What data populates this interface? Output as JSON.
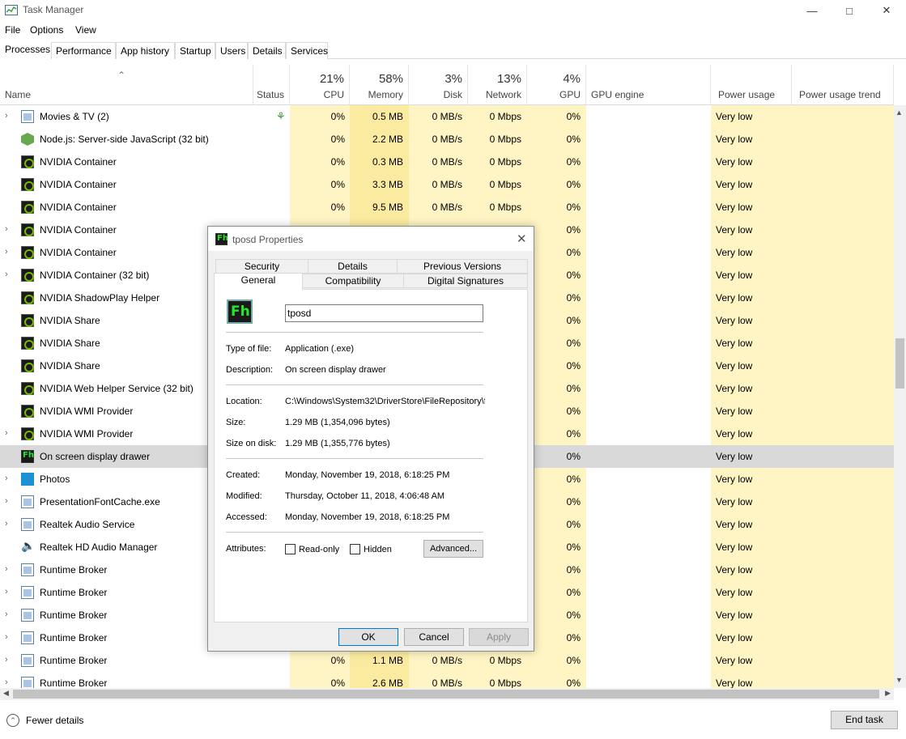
{
  "window": {
    "title": "Task Manager"
  },
  "menu": [
    "File",
    "Options",
    "View"
  ],
  "tabs": [
    "Processes",
    "Performance",
    "App history",
    "Startup",
    "Users",
    "Details",
    "Services"
  ],
  "header": {
    "name": "Name",
    "status": "Status",
    "cpu": {
      "pct": "21%",
      "label": "CPU"
    },
    "memory": {
      "pct": "58%",
      "label": "Memory"
    },
    "disk": {
      "pct": "3%",
      "label": "Disk"
    },
    "network": {
      "pct": "13%",
      "label": "Network"
    },
    "gpu": {
      "pct": "4%",
      "label": "GPU"
    },
    "gpu_engine": "GPU engine",
    "power": "Power usage",
    "power_trend": "Power usage trend"
  },
  "processes": [
    {
      "name": "Movies & TV (2)",
      "icon": "window-icon",
      "expand": true,
      "status": "leaf",
      "cpu": "0%",
      "memory": "0.5 MB",
      "disk": "0 MB/s",
      "network": "0 Mbps",
      "gpu": "0%",
      "power": "Very low"
    },
    {
      "name": "Node.js: Server-side JavaScript (32 bit)",
      "icon": "nodejs-icon",
      "expand": false,
      "cpu": "0%",
      "memory": "2.2 MB",
      "disk": "0 MB/s",
      "network": "0 Mbps",
      "gpu": "0%",
      "power": "Very low"
    },
    {
      "name": "NVIDIA Container",
      "icon": "nvidia-icon",
      "expand": false,
      "cpu": "0%",
      "memory": "0.3 MB",
      "disk": "0 MB/s",
      "network": "0 Mbps",
      "gpu": "0%",
      "power": "Very low"
    },
    {
      "name": "NVIDIA Container",
      "icon": "nvidia-icon",
      "expand": false,
      "cpu": "0%",
      "memory": "3.3 MB",
      "disk": "0 MB/s",
      "network": "0 Mbps",
      "gpu": "0%",
      "power": "Very low"
    },
    {
      "name": "NVIDIA Container",
      "icon": "nvidia-icon",
      "expand": false,
      "cpu": "0%",
      "memory": "9.5 MB",
      "disk": "0 MB/s",
      "network": "0 Mbps",
      "gpu": "0%",
      "power": "Very low"
    },
    {
      "name": "NVIDIA Container",
      "icon": "nvidia-icon",
      "expand": true,
      "cpu": "",
      "memory": "",
      "disk": "",
      "network": "",
      "gpu": "0%",
      "power": "Very low"
    },
    {
      "name": "NVIDIA Container",
      "icon": "nvidia-icon",
      "expand": true,
      "cpu": "",
      "memory": "",
      "disk": "",
      "network": "",
      "gpu": "0%",
      "power": "Very low"
    },
    {
      "name": "NVIDIA Container (32 bit)",
      "icon": "nvidia-icon",
      "expand": true,
      "cpu": "",
      "memory": "",
      "disk": "",
      "network": "",
      "gpu": "0%",
      "power": "Very low"
    },
    {
      "name": "NVIDIA ShadowPlay Helper",
      "icon": "nvidia-icon",
      "expand": false,
      "cpu": "",
      "memory": "",
      "disk": "",
      "network": "",
      "gpu": "0%",
      "power": "Very low"
    },
    {
      "name": "NVIDIA Share",
      "icon": "nvidia-icon",
      "expand": false,
      "cpu": "",
      "memory": "",
      "disk": "",
      "network": "",
      "gpu": "0%",
      "power": "Very low"
    },
    {
      "name": "NVIDIA Share",
      "icon": "nvidia-icon",
      "expand": false,
      "cpu": "",
      "memory": "",
      "disk": "",
      "network": "",
      "gpu": "0%",
      "power": "Very low"
    },
    {
      "name": "NVIDIA Share",
      "icon": "nvidia-icon",
      "expand": false,
      "cpu": "",
      "memory": "",
      "disk": "",
      "network": "",
      "gpu": "0%",
      "power": "Very low"
    },
    {
      "name": "NVIDIA Web Helper Service (32 bit)",
      "icon": "nvidia-icon",
      "expand": false,
      "cpu": "",
      "memory": "",
      "disk": "",
      "network": "",
      "gpu": "0%",
      "power": "Very low"
    },
    {
      "name": "NVIDIA WMI Provider",
      "icon": "nvidia-icon",
      "expand": false,
      "cpu": "",
      "memory": "",
      "disk": "",
      "network": "",
      "gpu": "0%",
      "power": "Very low"
    },
    {
      "name": "NVIDIA WMI Provider",
      "icon": "nvidia-icon",
      "expand": true,
      "cpu": "",
      "memory": "",
      "disk": "",
      "network": "",
      "gpu": "0%",
      "power": "Very low"
    },
    {
      "name": "On screen display drawer",
      "icon": "fh-icon",
      "expand": false,
      "selected": true,
      "cpu": "",
      "memory": "",
      "disk": "",
      "network": "",
      "gpu": "0%",
      "power": "Very low"
    },
    {
      "name": "Photos",
      "icon": "photos-icon",
      "expand": true,
      "cpu": "",
      "memory": "",
      "disk": "",
      "network": "",
      "gpu": "0%",
      "power": "Very low"
    },
    {
      "name": "PresentationFontCache.exe",
      "icon": "window-icon",
      "expand": true,
      "cpu": "",
      "memory": "",
      "disk": "",
      "network": "",
      "gpu": "0%",
      "power": "Very low"
    },
    {
      "name": "Realtek Audio Service",
      "icon": "window-icon",
      "expand": true,
      "cpu": "",
      "memory": "",
      "disk": "",
      "network": "",
      "gpu": "0%",
      "power": "Very low"
    },
    {
      "name": "Realtek HD Audio Manager",
      "icon": "speaker-icon",
      "expand": false,
      "cpu": "",
      "memory": "",
      "disk": "",
      "network": "",
      "gpu": "0%",
      "power": "Very low"
    },
    {
      "name": "Runtime Broker",
      "icon": "window-icon",
      "expand": true,
      "cpu": "",
      "memory": "",
      "disk": "",
      "network": "",
      "gpu": "0%",
      "power": "Very low"
    },
    {
      "name": "Runtime Broker",
      "icon": "window-icon",
      "expand": true,
      "cpu": "",
      "memory": "",
      "disk": "",
      "network": "",
      "gpu": "0%",
      "power": "Very low"
    },
    {
      "name": "Runtime Broker",
      "icon": "window-icon",
      "expand": true,
      "cpu": "",
      "memory": "",
      "disk": "",
      "network": "",
      "gpu": "0%",
      "power": "Very low"
    },
    {
      "name": "Runtime Broker",
      "icon": "window-icon",
      "expand": true,
      "cpu": "",
      "memory": "",
      "disk": "",
      "network": "",
      "gpu": "0%",
      "power": "Very low"
    },
    {
      "name": "Runtime Broker",
      "icon": "window-icon",
      "expand": true,
      "cpu": "0%",
      "memory": "1.1 MB",
      "disk": "0 MB/s",
      "network": "0 Mbps",
      "gpu": "0%",
      "power": "Very low"
    },
    {
      "name": "Runtime Broker",
      "icon": "window-icon",
      "expand": true,
      "cpu": "0%",
      "memory": "2.6 MB",
      "disk": "0 MB/s",
      "network": "0 Mbps",
      "gpu": "0%",
      "power": "Very low"
    }
  ],
  "footer": {
    "fewer_details": "Fewer details",
    "end_task": "End task"
  },
  "dialog": {
    "title": "tposd Properties",
    "tabs_row1": [
      "Security",
      "Details",
      "Previous Versions"
    ],
    "tabs_row2": [
      "General",
      "Compatibility",
      "Digital Signatures"
    ],
    "name_value": "tposd",
    "type_label": "Type of file:",
    "type_value": "Application (.exe)",
    "desc_label": "Description:",
    "desc_value": "On screen display drawer",
    "location_label": "Location:",
    "location_value": "C:\\Windows\\System32\\DriverStore\\FileRepository\\f",
    "size_label": "Size:",
    "size_value": "1.29 MB (1,354,096 bytes)",
    "sizeondisk_label": "Size on disk:",
    "sizeondisk_value": "1.29 MB (1,355,776 bytes)",
    "created_label": "Created:",
    "created_value": "Monday, November 19, 2018, 6:18:25 PM",
    "modified_label": "Modified:",
    "modified_value": "Thursday, October 11, 2018, 4:06:48 AM",
    "accessed_label": "Accessed:",
    "accessed_value": "Monday, November 19, 2018, 6:18:25 PM",
    "attributes_label": "Attributes:",
    "readonly_label": "Read-only",
    "hidden_label": "Hidden",
    "advanced_label": "Advanced...",
    "ok_label": "OK",
    "cancel_label": "Cancel",
    "apply_label": "Apply"
  }
}
